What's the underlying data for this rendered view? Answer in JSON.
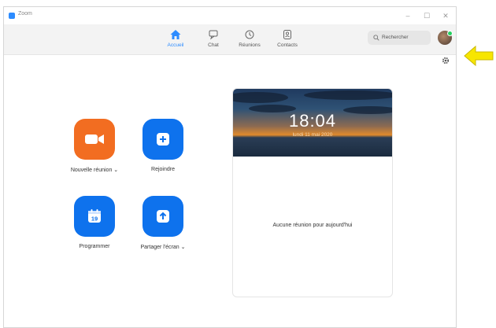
{
  "window": {
    "title": "Zoom"
  },
  "tabs": [
    {
      "label": "Accueil",
      "icon": "home-icon",
      "active": true
    },
    {
      "label": "Chat",
      "icon": "chat-icon",
      "active": false
    },
    {
      "label": "Réunions",
      "icon": "clock-icon",
      "active": false
    },
    {
      "label": "Contacts",
      "icon": "contacts-icon",
      "active": false
    }
  ],
  "search": {
    "placeholder": "Rechercher"
  },
  "actions": [
    {
      "label": "Nouvelle réunion ⌄",
      "icon": "video-camera-icon",
      "color": "#f26d21"
    },
    {
      "label": "Rejoindre",
      "icon": "plus-icon",
      "color": "#0e72ed"
    },
    {
      "label": "Programmer",
      "icon": "calendar-icon",
      "color": "#0e72ed",
      "calendar_day": "19"
    },
    {
      "label": "Partager l'écran ⌄",
      "icon": "share-screen-arrow-icon",
      "color": "#0e72ed"
    }
  ],
  "meeting_panel": {
    "time": "18:04",
    "date": "lundi 11 mai 2020",
    "empty_message": "Aucune réunion pour aujourd'hui"
  },
  "annotation": {
    "icon": "yellow-arrow-icon",
    "color": "#f7e600"
  }
}
